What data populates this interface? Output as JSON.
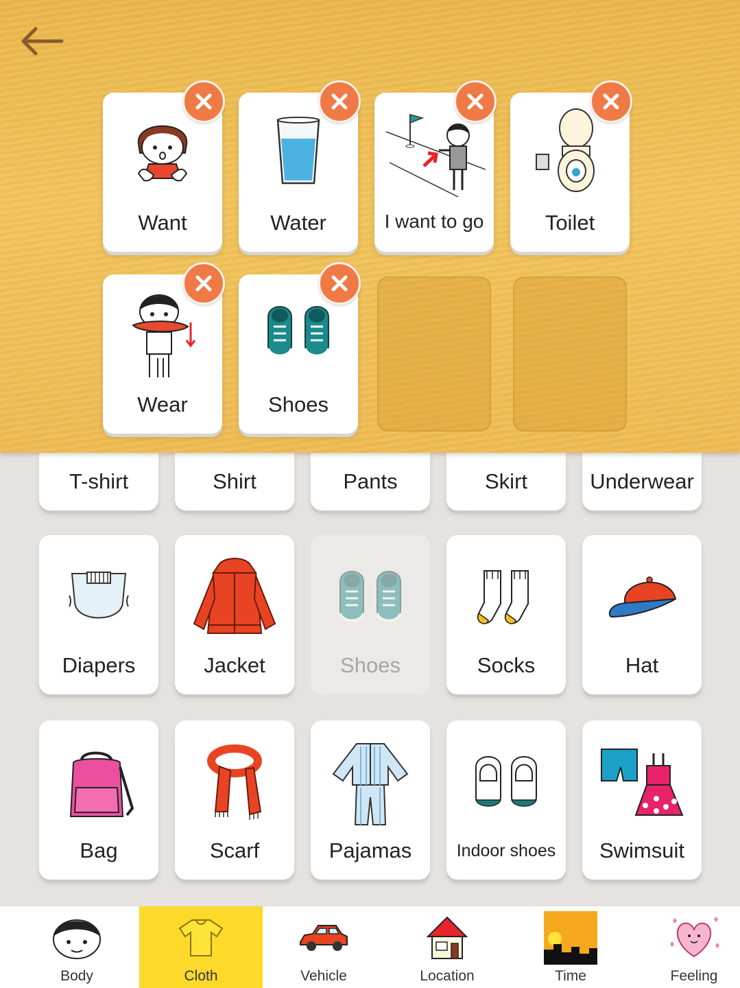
{
  "sentence": {
    "slots": [
      {
        "label": "Want",
        "icon": "want-icon"
      },
      {
        "label": "Water",
        "icon": "water-glass-icon"
      },
      {
        "label": "I want to go",
        "icon": "go-direction-icon"
      },
      {
        "label": "Toilet",
        "icon": "toilet-icon"
      },
      {
        "label": "Wear",
        "icon": "wear-icon"
      },
      {
        "label": "Shoes",
        "icon": "shoes-icon"
      }
    ],
    "remove_icon": "close-icon",
    "empty_slots": 2
  },
  "vocabulary": {
    "category": "Cloth",
    "row_top": [
      "T-shirt",
      "Shirt",
      "Pants",
      "Skirt",
      "Underwear"
    ],
    "row_mid": [
      {
        "label": "Diapers",
        "icon": "diapers-icon"
      },
      {
        "label": "Jacket",
        "icon": "jacket-icon"
      },
      {
        "label": "Shoes",
        "icon": "shoes-icon",
        "used": true
      },
      {
        "label": "Socks",
        "icon": "socks-icon"
      },
      {
        "label": "Hat",
        "icon": "hat-icon"
      }
    ],
    "row_bottom": [
      {
        "label": "Bag",
        "icon": "bag-icon"
      },
      {
        "label": "Scarf",
        "icon": "scarf-icon"
      },
      {
        "label": "Pajamas",
        "icon": "pajamas-icon"
      },
      {
        "label": "Indoor shoes",
        "icon": "indoor-shoes-icon"
      },
      {
        "label": "Swimsuit",
        "icon": "swimsuit-icon"
      }
    ]
  },
  "tabs": [
    {
      "label": "Body",
      "icon": "face-icon"
    },
    {
      "label": "Cloth",
      "icon": "tshirt-icon",
      "active": true
    },
    {
      "label": "Vehicle",
      "icon": "car-icon"
    },
    {
      "label": "Location",
      "icon": "house-icon"
    },
    {
      "label": "Time",
      "icon": "sunset-icon"
    },
    {
      "label": "Feeling",
      "icon": "heart-icon"
    }
  ],
  "colors": {
    "board": "#eebb52",
    "remove": "#f07a45",
    "active_tab": "#fdd92a"
  }
}
